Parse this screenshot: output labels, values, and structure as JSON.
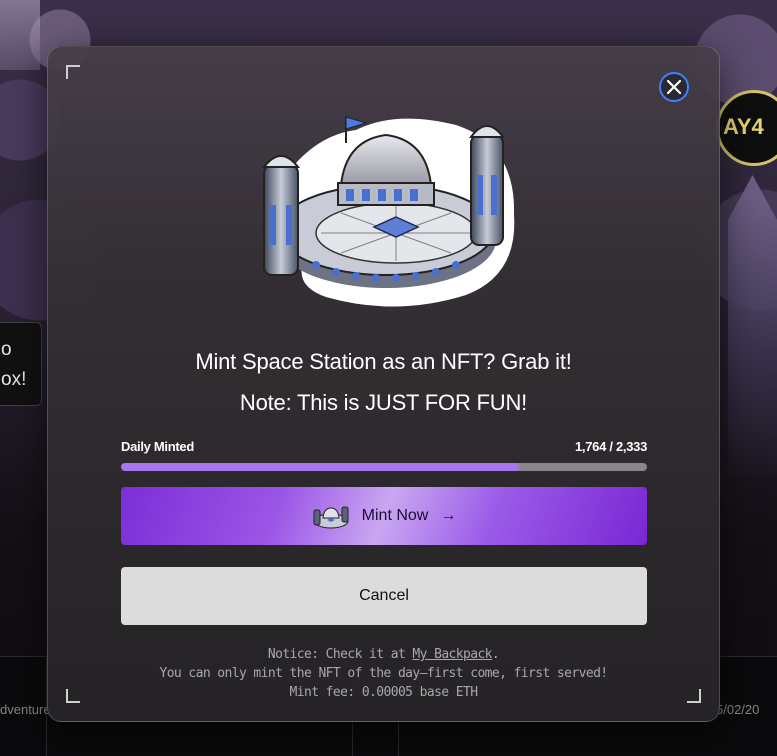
{
  "background": {
    "side_text_line1": "o",
    "side_text_line2": "ox!",
    "day_badge": "AY4",
    "bottom_left_text": "dventure",
    "bottom_right_text": "5/02/20"
  },
  "modal": {
    "close_icon": "close-icon",
    "hero_image": "space-station-illustration",
    "title_line1": "Mint Space Station as an NFT? Grab it!",
    "title_line2": "Note: This is JUST FOR FUN!",
    "progress": {
      "label": "Daily Minted",
      "count_text": "1,764 / 2,333",
      "minted": 1764,
      "total": 2333
    },
    "mint_button": {
      "label": "Mint Now",
      "arrow": "→"
    },
    "cancel_button": {
      "label": "Cancel"
    },
    "notice": {
      "line1_prefix": "Notice: Check it at ",
      "line1_link": "My Backpack",
      "line1_suffix": ".",
      "line2": "You can only mint the NFT of the day—first come, first served!",
      "line3": "Mint fee: 0.00005 base ETH"
    }
  },
  "colors": {
    "accent_purple": "#a676ee",
    "close_ring": "#3f7fff",
    "cancel_bg": "#dcdcdc"
  }
}
